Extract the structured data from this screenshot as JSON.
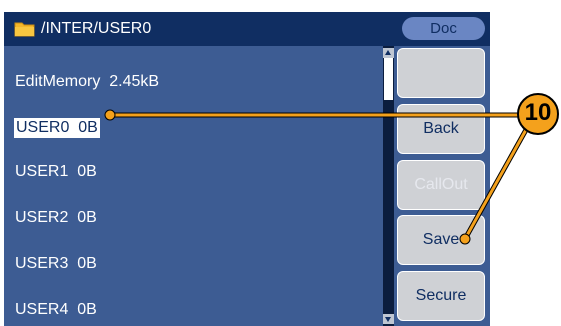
{
  "titlebar": {
    "path": "/INTER/USER0",
    "doc_label": "Doc"
  },
  "list": {
    "items": [
      {
        "label": "EditMemory  2.45kB",
        "selected": false
      },
      {
        "label": "USER0  0B",
        "selected": true
      },
      {
        "label": "USER1  0B",
        "selected": false
      },
      {
        "label": "USER2  0B",
        "selected": false
      },
      {
        "label": "USER3  0B",
        "selected": false
      },
      {
        "label": "USER4  0B",
        "selected": false
      }
    ]
  },
  "softkeys": [
    {
      "label": "",
      "enabled": true
    },
    {
      "label": "Back",
      "enabled": true
    },
    {
      "label": "CallOut",
      "enabled": false
    },
    {
      "label": "Save",
      "enabled": true
    },
    {
      "label": "Secure",
      "enabled": true
    }
  ],
  "callout": {
    "number": "10"
  },
  "colors": {
    "screen_bg": "#3d5c93",
    "titlebar_bg": "#102e62",
    "callout": "#f4a11c",
    "softkey_bg": "#cfd1d5"
  },
  "icons": {
    "folder": "folder-icon"
  }
}
